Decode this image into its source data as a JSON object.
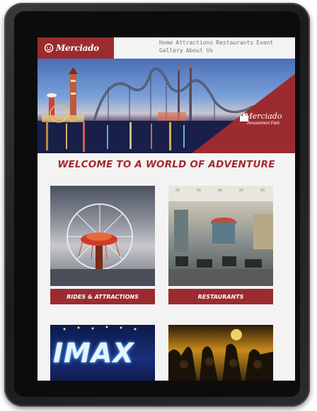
{
  "site": {
    "logo_text": "Merciado",
    "nav": [
      "Home",
      "Attractions",
      "Restaurants",
      "Event",
      "Gallery",
      "About Us"
    ]
  },
  "hero": {
    "park_name": "Merciado",
    "park_subtitle": "Amusement Park"
  },
  "welcome": "WELCOME TO A WORLD OF ADVENTURE",
  "cards": [
    {
      "label": "RIDES & ATTRACTIONS"
    },
    {
      "label": "RESTAURANTS"
    },
    {
      "label": "",
      "image_text": "IMAX"
    },
    {
      "label": ""
    }
  ],
  "colors": {
    "brand": "#9c2b2f",
    "heading": "#a62a2f",
    "bezel": "#1c1c1e"
  },
  "icons": [
    "smiley-logo-icon",
    "castle-icon"
  ]
}
